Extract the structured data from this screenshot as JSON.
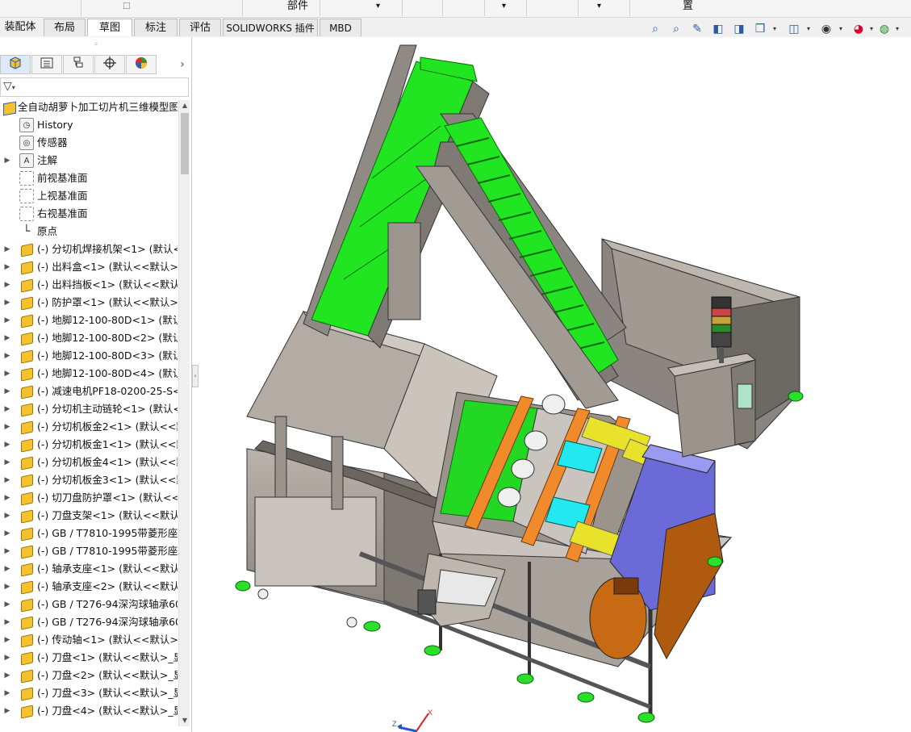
{
  "ribbon_top": {
    "labels": [
      "部件",
      "置"
    ]
  },
  "tabs": [
    {
      "label": "装配体",
      "active": false
    },
    {
      "label": "布局",
      "active": false
    },
    {
      "label": "草图",
      "active": true
    },
    {
      "label": "标注",
      "active": false
    },
    {
      "label": "评估",
      "active": false
    },
    {
      "label": "SOLIDWORKS 插件",
      "active": false
    },
    {
      "label": "MBD",
      "active": false
    }
  ],
  "view_tools": [
    "zoom-to-fit-icon",
    "zoom-area-icon",
    "previous-view-icon",
    "section-view-icon",
    "dynamic-annotation-icon",
    "view-orientation-icon",
    "display-style-icon",
    "hide-show-icon",
    "edit-appearance-icon",
    "apply-scene-icon"
  ],
  "feature_tree": {
    "root": "全自动胡萝卜加工切片机三维模型图",
    "items": [
      {
        "type": "history",
        "label": "History"
      },
      {
        "type": "sensor",
        "label": "传感器"
      },
      {
        "type": "annotation",
        "label": "注解"
      },
      {
        "type": "plane",
        "label": "前视基准面"
      },
      {
        "type": "plane",
        "label": "上视基准面"
      },
      {
        "type": "plane",
        "label": "右视基准面"
      },
      {
        "type": "origin",
        "label": "原点"
      },
      {
        "type": "part",
        "label": "(-) 分切机焊接机架<1> (默认<<"
      },
      {
        "type": "part",
        "label": "(-) 出料盒<1> (默认<<默认>_显"
      },
      {
        "type": "part",
        "label": "(-) 出料挡板<1> (默认<<默认>_"
      },
      {
        "type": "part",
        "label": "(-) 防护罩<1> (默认<<默认>_显"
      },
      {
        "type": "part",
        "label": "(-) 地脚12-100-80D<1> (默认<"
      },
      {
        "type": "part",
        "label": "(-) 地脚12-100-80D<2> (默认<"
      },
      {
        "type": "part",
        "label": "(-) 地脚12-100-80D<3> (默认<"
      },
      {
        "type": "part",
        "label": "(-) 地脚12-100-80D<4> (默认<"
      },
      {
        "type": "part",
        "label": "(-) 减速电机PF18-0200-25-S<1"
      },
      {
        "type": "part",
        "label": "(-) 分切机主动链轮<1> (默认<<"
      },
      {
        "type": "part",
        "label": "(-) 分切机板金2<1> (默认<<默"
      },
      {
        "type": "part",
        "label": "(-) 分切机板金1<1> (默认<<默"
      },
      {
        "type": "part",
        "label": "(-) 分切机板金4<1> (默认<<默"
      },
      {
        "type": "part",
        "label": "(-) 分切机板金3<1> (默认<<默"
      },
      {
        "type": "part",
        "label": "(-) 切刀盘防护罩<1> (默认<<默"
      },
      {
        "type": "part",
        "label": "(-) 刀盘支架<1> (默认<<默认>_"
      },
      {
        "type": "part",
        "label": "(-) GB / T7810-1995带菱形座轴"
      },
      {
        "type": "part",
        "label": "(-) GB / T7810-1995带菱形座轴"
      },
      {
        "type": "part",
        "label": "(-) 轴承支座<1> (默认<<默认>_"
      },
      {
        "type": "part",
        "label": "(-) 轴承支座<2> (默认<<默认>_"
      },
      {
        "type": "part",
        "label": "(-) GB / T276-94深沟球轴承600"
      },
      {
        "type": "part",
        "label": "(-) GB / T276-94深沟球轴承600"
      },
      {
        "type": "part",
        "label": "(-) 传动轴<1> (默认<<默认>_显"
      },
      {
        "type": "part",
        "label": "(-) 刀盘<1> (默认<<默认>_显示"
      },
      {
        "type": "part",
        "label": "(-) 刀盘<2> (默认<<默认>_显示"
      },
      {
        "type": "part",
        "label": "(-) 刀盘<3> (默认<<默认>_显示"
      },
      {
        "type": "part",
        "label": "(-) 刀盘<4> (默认<<默认>_显示"
      }
    ]
  },
  "triad": {
    "x": "X",
    "y": "Y",
    "z": "Z"
  },
  "colors": {
    "conveyor_green": "#22e522",
    "frame_gray": "#8a8580",
    "motor_orange": "#c86a14",
    "motor_blue": "#6a6ad8",
    "cyan": "#22d8e8",
    "yellow": "#e8e22a",
    "bracket_orange": "#f08a2a"
  }
}
